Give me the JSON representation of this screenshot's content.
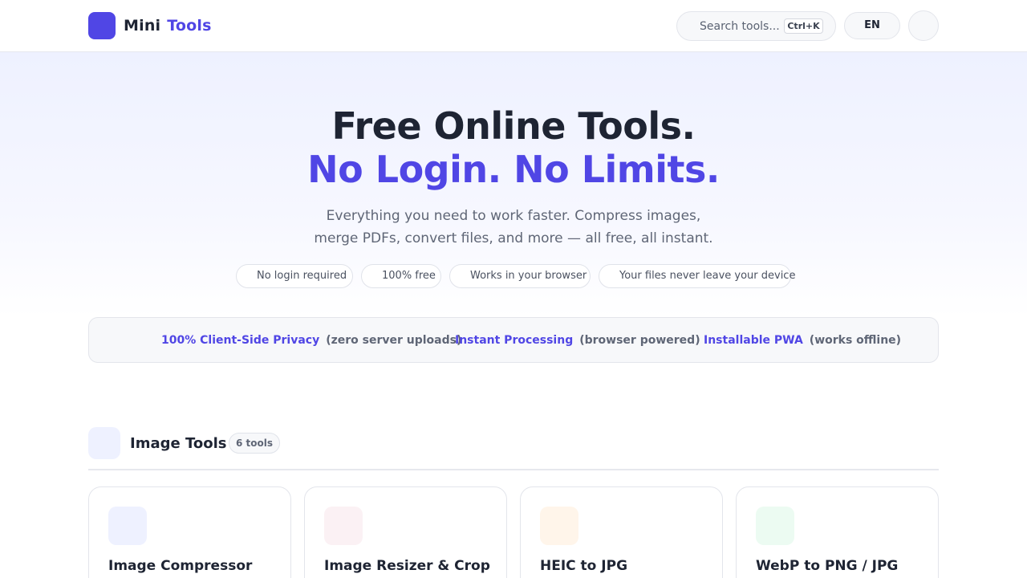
{
  "header": {
    "logo_word1": "Mini",
    "logo_word2": "Tools",
    "search_placeholder": "Search tools...",
    "search_shortcut": "Ctrl+K",
    "language": "EN"
  },
  "hero": {
    "title_line1": "Free Online Tools.",
    "title_line2": "No Login. No Limits.",
    "subtitle": "Everything you need to work faster. Compress images, merge PDFs, convert files, and more — all free, all instant.",
    "badges": [
      {
        "label": "No login required"
      },
      {
        "label": "100% free"
      },
      {
        "label": "Works in your browser"
      },
      {
        "label": "Your files never leave your device"
      }
    ]
  },
  "features": [
    {
      "strong": "100% Client-Side Privacy",
      "muted": "(zero server uploads)"
    },
    {
      "strong": "Instant Processing",
      "muted": "(browser powered)"
    },
    {
      "strong": "Installable PWA",
      "muted": "(works offline)"
    }
  ],
  "section": {
    "title": "Image Tools",
    "count": "6 tools",
    "cards": [
      {
        "title": "Image Compressor",
        "icon_color": "#eef1ff"
      },
      {
        "title": "Image Resizer & Crop",
        "icon_color": "#fbf1f4"
      },
      {
        "title": "HEIC to JPG",
        "icon_color": "#fff5ea"
      },
      {
        "title": "WebP to PNG / JPG",
        "icon_color": "#ecfbf2"
      }
    ]
  },
  "colors": {
    "accent": "#5046e5",
    "text": "#1e2433",
    "muted": "#5f6676"
  }
}
